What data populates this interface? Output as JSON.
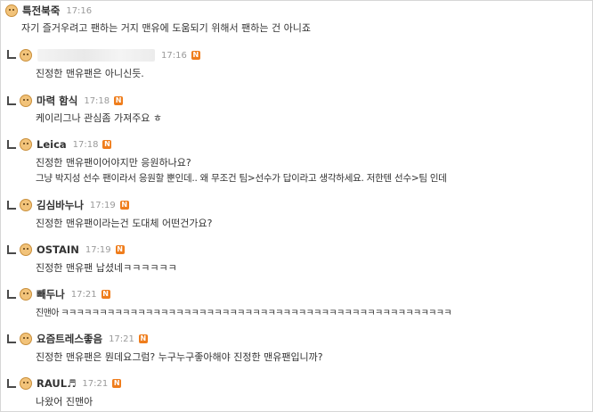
{
  "comments": [
    {
      "nick": "특전북죽",
      "time": "17:16",
      "badge": "N",
      "lines": [
        "자기 즐거우려고 팬하는 거지 맨유에 도움되기 위해서 팬하는 건 아니죠"
      ]
    },
    {
      "nick": "",
      "time": "17:16",
      "badge": "N",
      "lines": [
        "진정한 맨유팬은 아니신듯."
      ]
    },
    {
      "nick": "마력 함식",
      "time": "17:18",
      "badge": "N",
      "lines": [
        "케이리그나 관심좀 가져주요 ㅎ"
      ]
    },
    {
      "nick": "Leica",
      "time": "17:18",
      "badge": "N",
      "lines": [
        "진정한 맨유팬이어야지만 응원하나요?",
        "그냥 박지성 선수 팬이라서 응원할 뿐인데.. 왜 무조건 팀>선수가 답이라고 생각하세요. 저한텐 선수>팀 인데"
      ]
    },
    {
      "nick": "김심바누나",
      "time": "17:19",
      "badge": "N",
      "lines": [
        "진정한 맨유팬이라는건 도대체 어떤건가요?"
      ]
    },
    {
      "nick": "OSTAIN",
      "time": "17:19",
      "badge": "N",
      "lines": [
        "진정한 맨유팬 납셨네ㅋㅋㅋㅋㅋㅋ"
      ]
    },
    {
      "nick": "빼두나",
      "time": "17:21",
      "badge": "N",
      "lines": [
        "진맨아 ㅋㅋㅋㅋㅋㅋㅋㅋㅋㅋㅋㅋㅋㅋㅋㅋㅋㅋㅋㅋㅋㅋㅋㅋㅋㅋㅋㅋㅋㅋㅋㅋㅋㅋㅋㅋㅋㅋㅋㅋㅋㅋㅋㅋㅋㅋㅋㅋㅋㅋㅋ"
      ]
    },
    {
      "nick": "요즘트레스좋음",
      "time": "17:21",
      "badge": "N",
      "lines": [
        "진정한 맨유팬은 뭔데요그럼? 누구누구좋아해야 진정한 맨유팬입니까?"
      ]
    },
    {
      "nick": "RAUL♬",
      "time": "17:21",
      "badge": "N",
      "lines": [
        "나왔어 진맨아"
      ]
    }
  ]
}
